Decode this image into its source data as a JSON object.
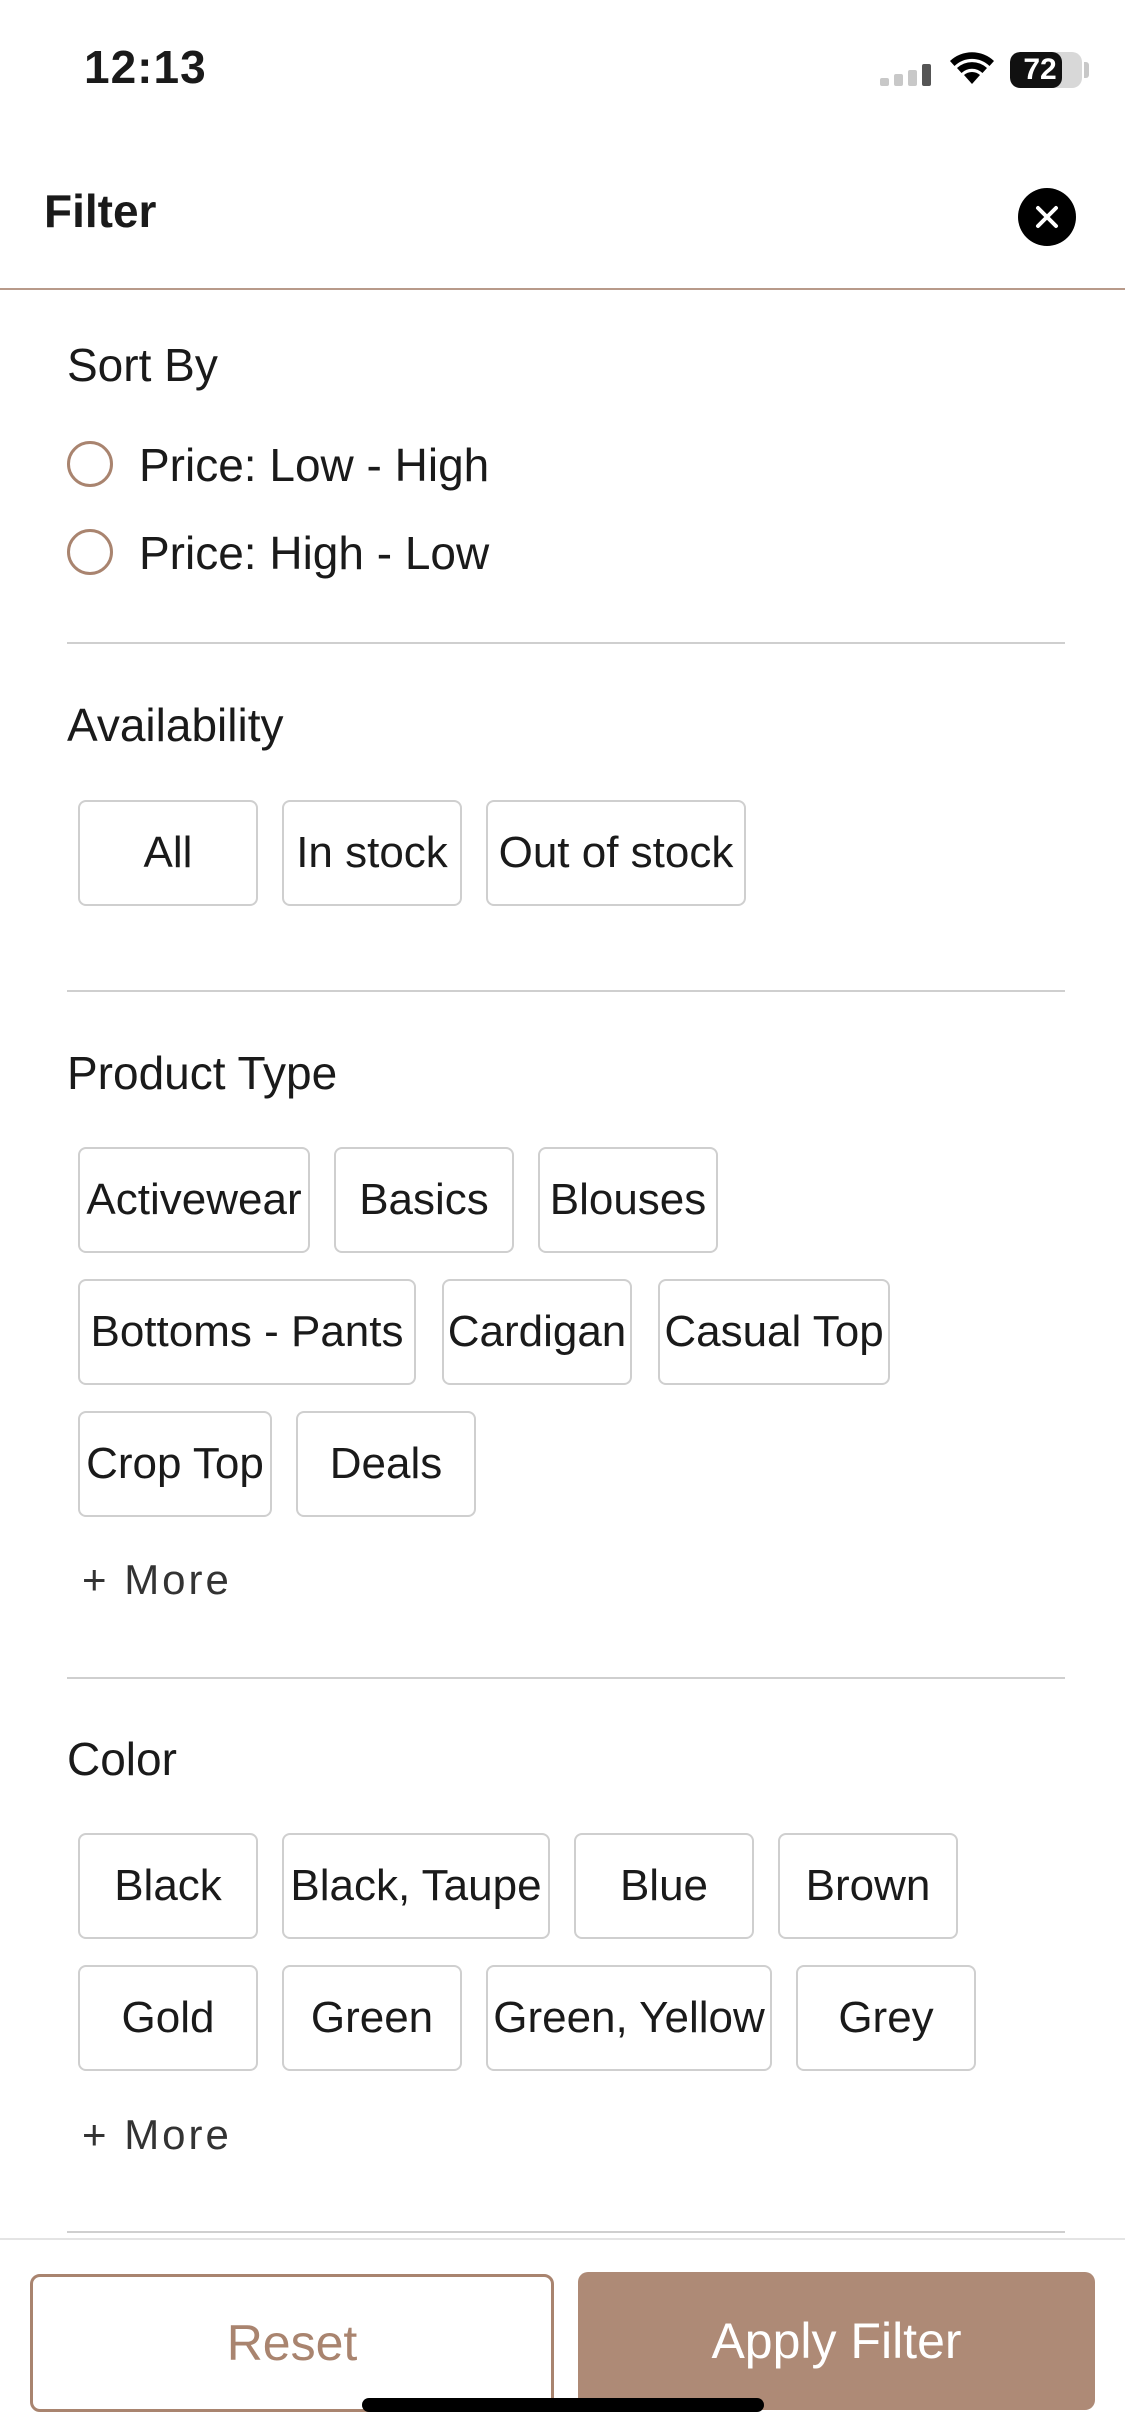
{
  "status_bar": {
    "time": "12:13",
    "battery_level": "72",
    "battery_fraction": 0.72
  },
  "header": {
    "title": "Filter",
    "close_icon": "close-icon"
  },
  "sort_by": {
    "title": "Sort By",
    "options": [
      "Price: Low - High",
      "Price: High - Low"
    ]
  },
  "availability": {
    "title": "Availability",
    "options": [
      "All",
      "In stock",
      "Out of stock"
    ]
  },
  "product_type": {
    "title": "Product Type",
    "options": [
      "Activewear",
      "Basics",
      "Blouses",
      "Bottoms - Pants",
      "Cardigan",
      "Casual Top",
      "Crop Top",
      "Deals"
    ],
    "more_label": "+ More"
  },
  "color": {
    "title": "Color",
    "options": [
      "Black",
      "Black, Taupe",
      "Blue",
      "Brown",
      "Gold",
      "Green",
      "Green, Yellow",
      "Grey"
    ],
    "more_label": "+ More"
  },
  "footer": {
    "reset_label": "Reset",
    "apply_label": "Apply Filter"
  },
  "colors": {
    "accent": "#ae8a76",
    "accent_border": "#a9846f",
    "chip_border": "#cfcfcf"
  }
}
